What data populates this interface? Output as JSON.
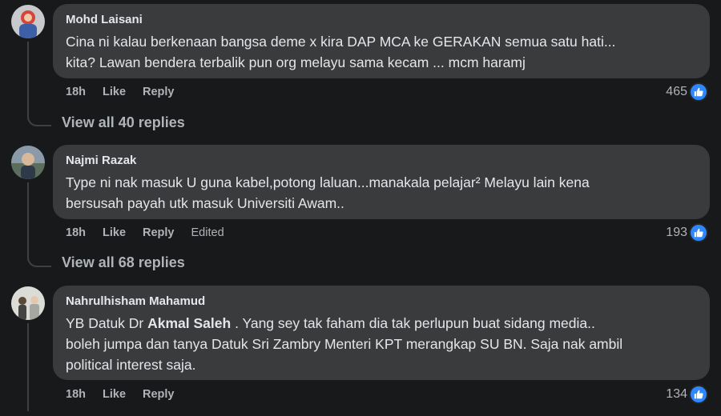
{
  "comments": [
    {
      "author": "Mohd Laisani",
      "line1": "Cina ni kalau berkenaan bangsa deme x kira DAP MCA ke GERAKAN semua satu hati...",
      "line2": "kita? Lawan bendera terbalik pun org melayu sama kecam ... mcm haramj",
      "time": "18h",
      "like": "Like",
      "reply": "Reply",
      "reactions": "465",
      "view_replies": "View all 40 replies"
    },
    {
      "author": "Najmi Razak",
      "line1": "Type ni nak masuk U guna kabel,potong laluan...manakala pelajar² Melayu lain kena",
      "line2": "bersusah payah utk masuk Universiti Awam..",
      "time": "18h",
      "like": "Like",
      "reply": "Reply",
      "edited": "Edited",
      "reactions": "193",
      "view_replies": "View all 68 replies"
    },
    {
      "author": "Nahrulhisham Mahamud",
      "line1_pre": "YB Datuk Dr ",
      "line1_bold": "Akmal Saleh",
      "line1_post": " . Yang sey tak faham dia tak perlupun buat sidang media..",
      "line2": "boleh jumpa dan tanya Datuk Sri Zambry Menteri KPT merangkap SU BN. Saja nak ambil",
      "line3": "political interest saja.",
      "time": "18h",
      "like": "Like",
      "reply": "Reply",
      "reactions": "134"
    }
  ],
  "colors": {
    "background": "#18191a",
    "bubble": "#3a3b3c",
    "accent_like": "#2d88ff",
    "secondary_text": "#b0b3b8"
  },
  "icons": [
    "thumbs-up-icon"
  ]
}
